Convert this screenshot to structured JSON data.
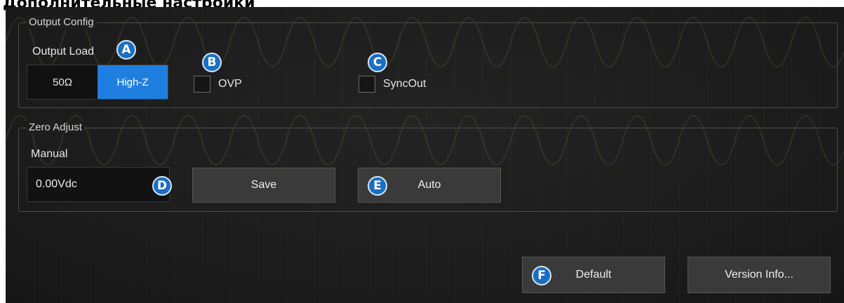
{
  "doc_title": "Дополнительные настройки",
  "output_config": {
    "title": "Output Config",
    "output_load_label": "Output Load",
    "load_options": [
      "50Ω",
      "High-Z"
    ],
    "selected_load": "High-Z",
    "ovp_label": "OVP",
    "ovp_checked": false,
    "syncout_label": "SyncOut",
    "syncout_checked": false
  },
  "zero_adjust": {
    "title": "Zero Adjust",
    "manual_label": "Manual",
    "value": "0.00Vdc",
    "save_label": "Save",
    "auto_label": "Auto"
  },
  "footer": {
    "default_label": "Default",
    "version_label": "Version Info..."
  },
  "callouts": {
    "a": "A",
    "b": "B",
    "c": "C",
    "d": "D",
    "e": "E",
    "f": "F"
  },
  "colors": {
    "background": "#1d1d1d",
    "accent": "#1f7fe0",
    "callout": "#1b6fc2"
  }
}
